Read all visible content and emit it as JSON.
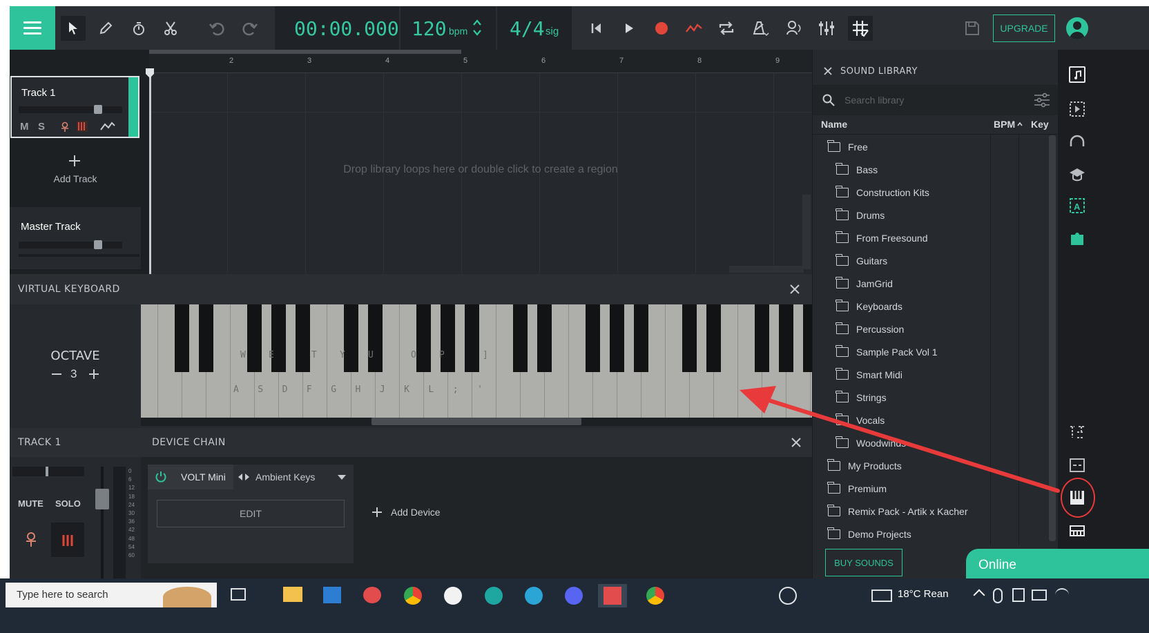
{
  "topbar": {
    "time": "00:00.000",
    "bpm_value": "120",
    "bpm_unit": "bpm",
    "sig_value": "4/4",
    "sig_unit": "sig",
    "upgrade_label": "UPGRADE"
  },
  "tracks": {
    "track1_name": "Track 1",
    "mute_short": "M",
    "solo_short": "S",
    "add_track_label": "Add Track",
    "master_name": "Master Track"
  },
  "timeline": {
    "ruler": [
      "2",
      "3",
      "4",
      "5",
      "6",
      "7",
      "8",
      "9"
    ],
    "drop_hint": "Drop library loops here or double click to create a region"
  },
  "virtual_keyboard": {
    "title": "VIRTUAL KEYBOARD",
    "octave_label": "OCTAVE",
    "octave_value": "3",
    "black_hints": [
      "W",
      "E",
      "T",
      "Y",
      "U",
      "O",
      "P",
      "]"
    ],
    "white_hints": [
      "A",
      "S",
      "D",
      "F",
      "G",
      "H",
      "J",
      "K",
      "L",
      ";",
      "'"
    ]
  },
  "track_panel": {
    "title": "TRACK 1",
    "mute": "MUTE",
    "solo": "SOLO",
    "meter_scale": [
      "0",
      "6",
      "12",
      "18",
      "24",
      "30",
      "36",
      "42",
      "48",
      "54",
      "60"
    ]
  },
  "device_chain": {
    "title": "DEVICE CHAIN",
    "device_name": "VOLT Mini",
    "preset": "Ambient Keys",
    "edit": "EDIT",
    "add_device": "Add Device"
  },
  "library": {
    "title": "SOUND LIBRARY",
    "search_placeholder": "Search library",
    "col_name": "Name",
    "col_bpm": "BPM",
    "col_key": "Key",
    "items": [
      {
        "label": "Free",
        "level": 0
      },
      {
        "label": "Bass",
        "level": 1
      },
      {
        "label": "Construction Kits",
        "level": 1
      },
      {
        "label": "Drums",
        "level": 1
      },
      {
        "label": "From Freesound",
        "level": 1
      },
      {
        "label": "Guitars",
        "level": 1
      },
      {
        "label": "JamGrid",
        "level": 1
      },
      {
        "label": "Keyboards",
        "level": 1
      },
      {
        "label": "Percussion",
        "level": 1
      },
      {
        "label": "Sample Pack Vol 1",
        "level": 1
      },
      {
        "label": "Smart Midi",
        "level": 1
      },
      {
        "label": "Strings",
        "level": 1
      },
      {
        "label": "Vocals",
        "level": 1
      },
      {
        "label": "Woodwinds",
        "level": 1
      },
      {
        "label": "My Products",
        "level": 0
      },
      {
        "label": "Premium",
        "level": 0
      },
      {
        "label": "Remix Pack - Artik x Kacher",
        "level": 0
      },
      {
        "label": "Demo Projects",
        "level": 0
      }
    ],
    "buy_sounds": "BUY SOUNDS"
  },
  "chat": {
    "label": "Online"
  },
  "taskbar": {
    "search_text": "Type here to search",
    "weather": "18°C  Rean"
  },
  "colors": {
    "accent": "#2ec39b",
    "record": "#e2463a",
    "annotation_arrow": "#e83a3a"
  }
}
